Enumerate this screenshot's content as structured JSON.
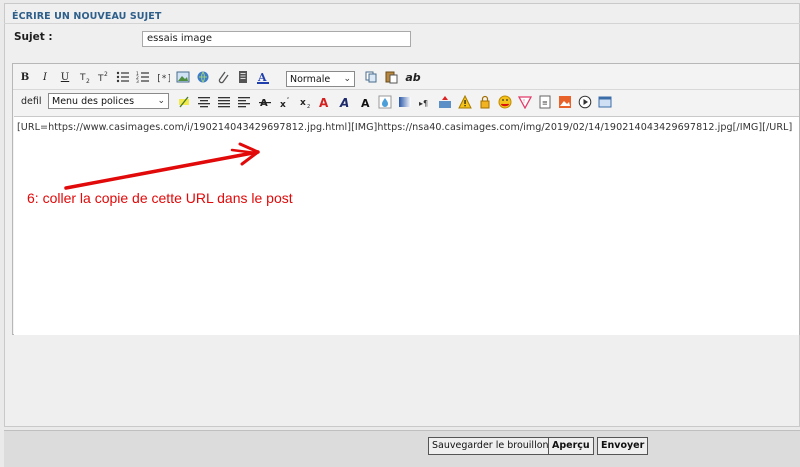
{
  "panel": {
    "title": "ÉCRIRE UN NOUVEAU SUJET"
  },
  "subject": {
    "label": "Sujet :",
    "value": "essais image"
  },
  "toolbar": {
    "row1": {
      "bold": "B",
      "italic": "I",
      "underline": "U",
      "size_select": "Normale",
      "ab": "ab"
    },
    "row2": {
      "defil": "defil",
      "font_select": "Menu des polices"
    }
  },
  "editor": {
    "content": "[URL=https://www.casimages.com/i/190214043429697812.jpg.html][IMG]https://nsa40.casimages.com/img/2019/02/14/190214043429697812.jpg[/IMG][/URL]"
  },
  "annotation": {
    "text": "6:  coller la copie de cette URL dans  le post",
    "color": "#e10909"
  },
  "footer": {
    "save_draft": "Sauvegarder le brouillon",
    "preview": "Aperçu",
    "send": "Envoyer"
  },
  "colors": {
    "title": "#2e5f8a",
    "annotation": "#e10909"
  }
}
